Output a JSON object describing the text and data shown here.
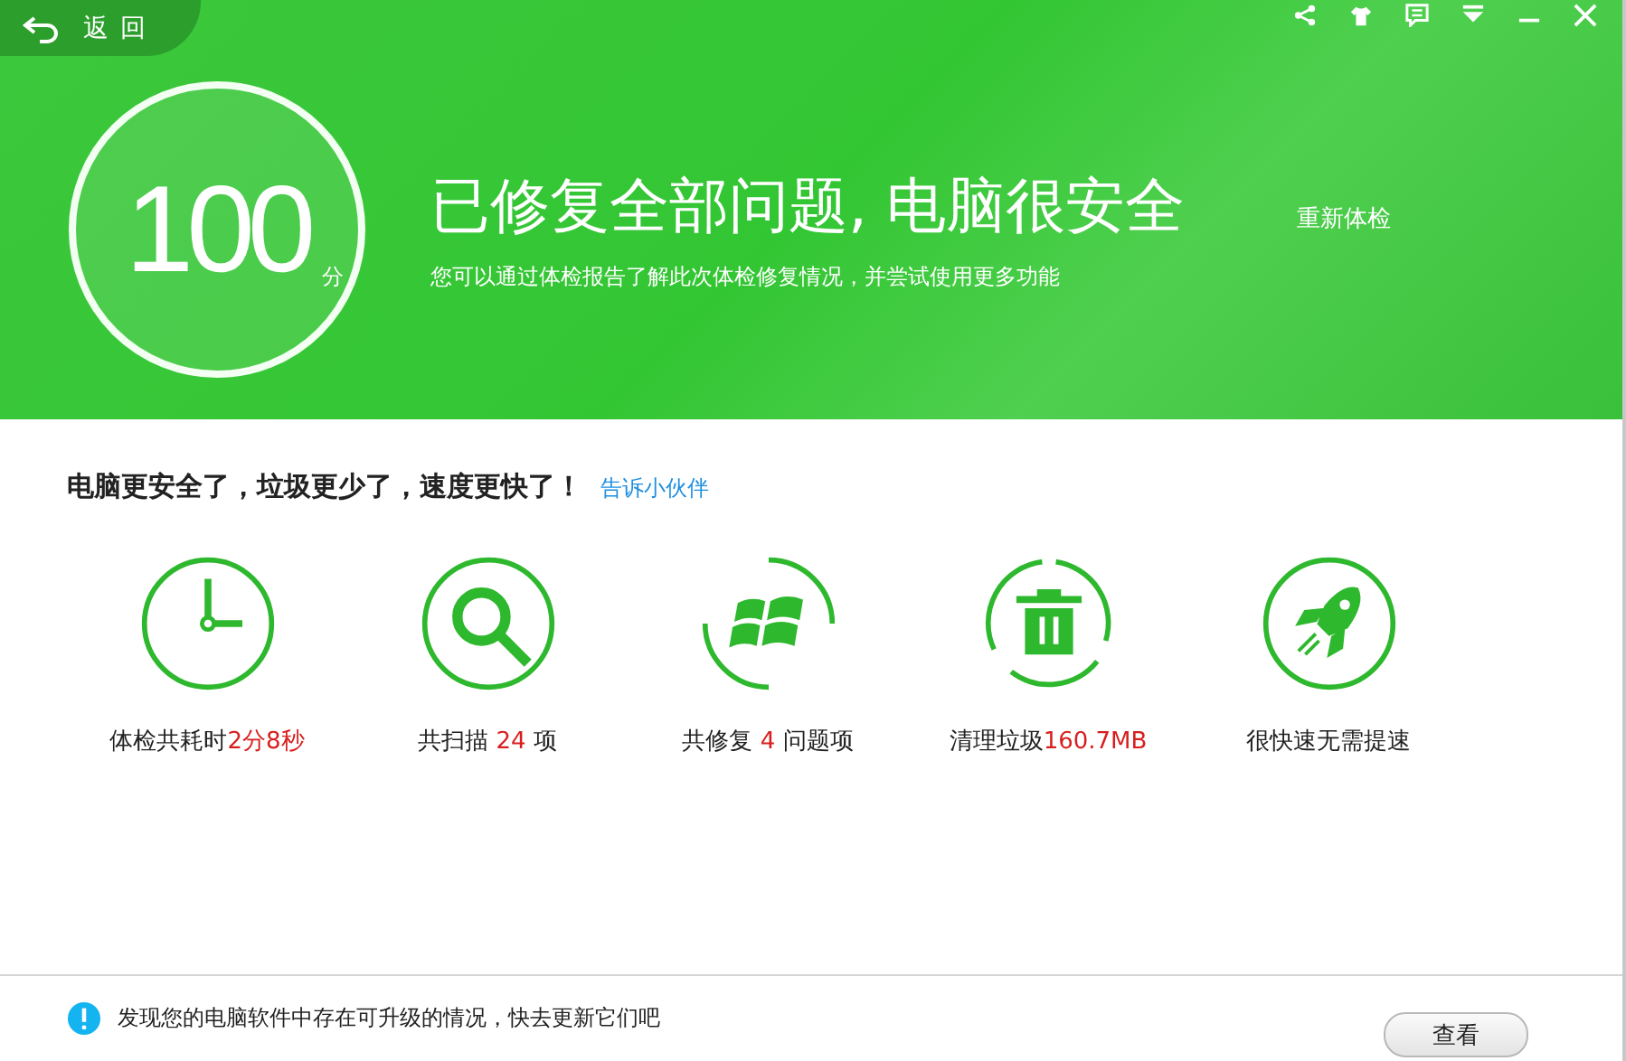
{
  "back_button": {
    "label": "返 回"
  },
  "window_controls": [
    {
      "kind": "share"
    },
    {
      "kind": "shirt"
    },
    {
      "kind": "feedback"
    },
    {
      "kind": "menu"
    },
    {
      "kind": "minimize"
    },
    {
      "kind": "close"
    }
  ],
  "score": {
    "value": "100",
    "unit": "分"
  },
  "headline": "已修复全部问题, 电脑很安全",
  "subtitle": "您可以通过体检报告了解此次体检修复情况，并尝试使用更多功能",
  "recheck_link": "重新体检",
  "summary": {
    "text": "电脑更安全了，垃圾更少了，速度更快了！",
    "share_link": "告诉小伙伴"
  },
  "stats": [
    {
      "kind": "clock",
      "parts": [
        {
          "text": "体检共耗时",
          "highlight": false
        },
        {
          "text": "2分8秒",
          "highlight": true
        }
      ]
    },
    {
      "kind": "search",
      "parts": [
        {
          "text": "共扫描 ",
          "highlight": false
        },
        {
          "text": "24",
          "highlight": true
        },
        {
          "text": " 项",
          "highlight": false
        }
      ]
    },
    {
      "kind": "windows",
      "parts": [
        {
          "text": "共修复 ",
          "highlight": false
        },
        {
          "text": "4",
          "highlight": true
        },
        {
          "text": " 问题项",
          "highlight": false
        }
      ]
    },
    {
      "kind": "trash",
      "parts": [
        {
          "text": "清理垃圾",
          "highlight": false
        },
        {
          "text": "160.7MB",
          "highlight": true
        }
      ]
    },
    {
      "kind": "rocket",
      "parts": [
        {
          "text": "很快速无需提速",
          "highlight": false
        }
      ]
    }
  ],
  "notice": {
    "text": "发现您的电脑软件中存在可升级的情况，快去更新它们吧",
    "button": "查看"
  }
}
